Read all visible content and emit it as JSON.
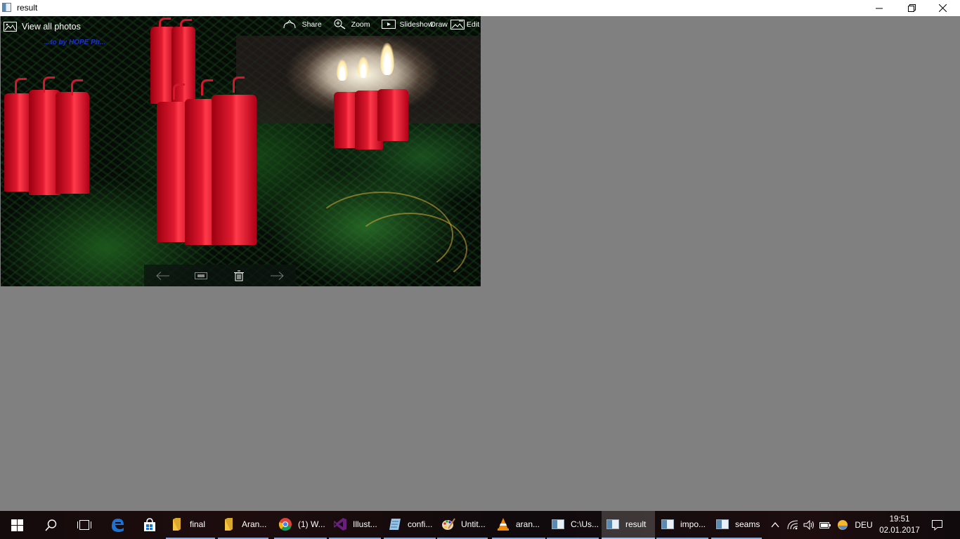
{
  "window": {
    "title": "result",
    "minimize_label": "—",
    "restore_label": "❐",
    "close_label": "✕"
  },
  "photo_viewer": {
    "view_all_label": "View all photos",
    "watermark_text": "...to by HOPE Ph...",
    "toolbar": {
      "share_label": "Share",
      "zoom_label": "Zoom",
      "slideshow_label": "Slideshow",
      "draw_label": "Draw",
      "edit_label": "Edit"
    },
    "nav": {
      "prev_icon": "arrow-left-icon",
      "slideshow_icon": "slideshow-icon",
      "delete_icon": "trash-icon",
      "next_icon": "arrow-right-icon"
    },
    "image_description_icon": "photo-icon"
  },
  "taskbar": {
    "tasks": [
      {
        "label": "final",
        "icon": "folder-icon",
        "running": true,
        "active": false
      },
      {
        "label": "Aran...",
        "icon": "folder-icon",
        "running": true,
        "active": false
      },
      {
        "label": "(1) W...",
        "icon": "chrome-icon",
        "running": true,
        "active": false
      },
      {
        "label": "Illust...",
        "icon": "visual-studio-icon",
        "running": true,
        "active": false
      },
      {
        "label": "confi...",
        "icon": "notepad-icon",
        "running": true,
        "active": false
      },
      {
        "label": "Untit...",
        "icon": "paint-icon",
        "running": true,
        "active": false
      },
      {
        "label": "aran...",
        "icon": "vlc-icon",
        "running": true,
        "active": false
      },
      {
        "label": "C:\\Us...",
        "icon": "window-icon",
        "running": true,
        "active": false
      },
      {
        "label": "result",
        "icon": "window-icon",
        "running": true,
        "active": true
      },
      {
        "label": "impo...",
        "icon": "window-icon",
        "running": true,
        "active": false
      },
      {
        "label": "seams",
        "icon": "window-icon",
        "running": true,
        "active": false
      }
    ],
    "tray": {
      "language": "DEU",
      "time": "19:51",
      "date": "02.01.2017"
    },
    "colors": {
      "running_underline": "#8aa9d6",
      "edge_blue": "#1e73d2",
      "folder_yellow": "#f5c542"
    }
  }
}
